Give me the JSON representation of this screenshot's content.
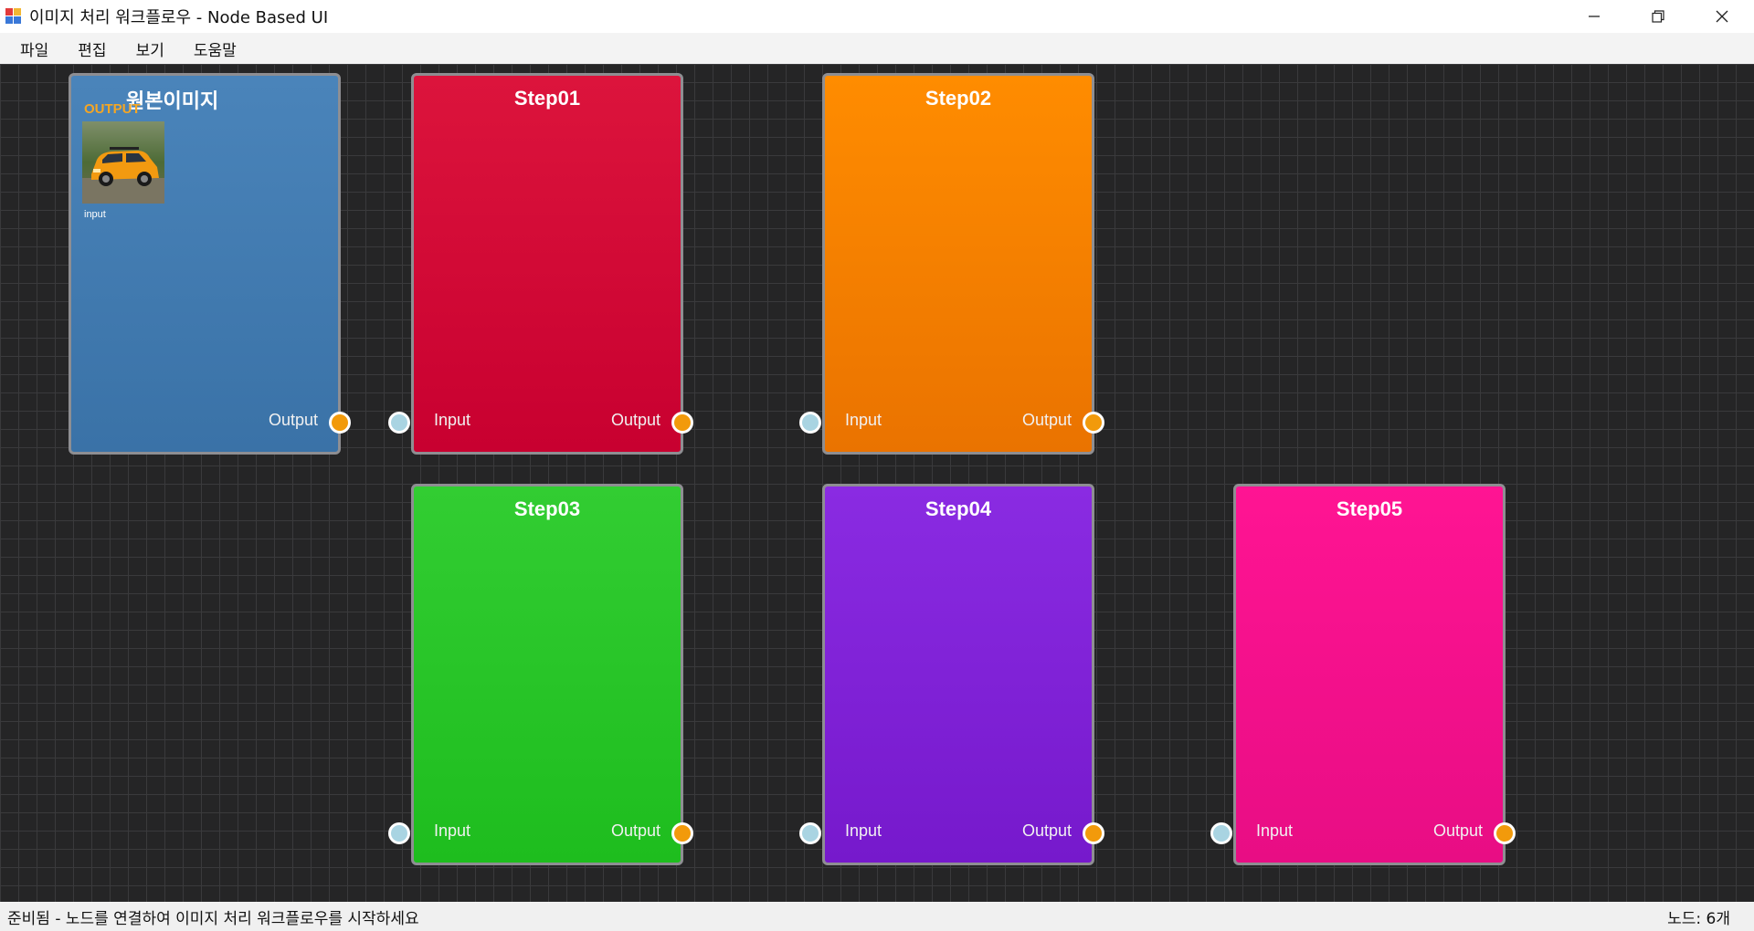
{
  "window": {
    "title": "이미지 처리 워크플로우 - Node Based UI"
  },
  "menu": {
    "items": [
      {
        "label": "파일"
      },
      {
        "label": "편집"
      },
      {
        "label": "보기"
      },
      {
        "label": "도움말"
      }
    ]
  },
  "nodes": {
    "source": {
      "title": "원본이미지",
      "output_tag": "OUTPUT",
      "thumb_caption": "input",
      "output_label": "Output"
    },
    "step01": {
      "title": "Step01",
      "input_label": "Input",
      "output_label": "Output"
    },
    "step02": {
      "title": "Step02",
      "input_label": "Input",
      "output_label": "Output"
    },
    "step03": {
      "title": "Step03",
      "input_label": "Input",
      "output_label": "Output"
    },
    "step04": {
      "title": "Step04",
      "input_label": "Input",
      "output_label": "Output"
    },
    "step05": {
      "title": "Step05",
      "input_label": "Input",
      "output_label": "Output"
    }
  },
  "colors": {
    "source": "#4a84ba",
    "step01": "#dc143c",
    "step02": "#ff8c00",
    "step03": "#32cd32",
    "step04": "#8a2be2",
    "step05": "#ff1493",
    "output_port": "#f29a0b",
    "input_port": "#a9d4e2"
  },
  "status": {
    "message": "준비됨 - 노드를 연결하여 이미지 처리 워크플로우를 시작하세요",
    "node_count": "노드: 6개"
  }
}
